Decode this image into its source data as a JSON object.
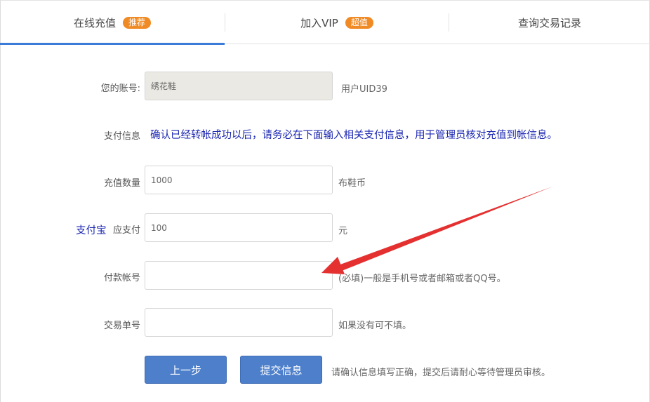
{
  "tabs": [
    {
      "label": "在线充值",
      "badge": "推荐",
      "active": true
    },
    {
      "label": "加入VIP",
      "badge": "超值",
      "active": false
    },
    {
      "label": "查询交易记录",
      "badge": "",
      "active": false
    }
  ],
  "form": {
    "account": {
      "label": "您的账号:",
      "value": "绣花鞋",
      "suffix": "用户UID39"
    },
    "payinfo": {
      "label": "支付信息",
      "notice": "确认已经转帐成功以后，请务必在下面输入相关支付信息，用于管理员核对充值到帐信息。"
    },
    "amount": {
      "label": "充值数量",
      "value": "1000",
      "unit": "布鞋币"
    },
    "pay": {
      "method": "支付宝",
      "label": "应支付",
      "value": "100",
      "unit": "元"
    },
    "payer_account": {
      "label": "付款帐号",
      "value": "",
      "hint": "(必填)一般是手机号或者邮箱或者QQ号。"
    },
    "trade_no": {
      "label": "交易单号",
      "value": "",
      "hint": "如果没有可不填。"
    }
  },
  "buttons": {
    "prev": "上一步",
    "submit": "提交信息"
  },
  "footnote": "请确认信息填写正确，提交后请耐心等待管理员审核。",
  "colors": {
    "accent": "#3d7bd9",
    "badge": "#f08a24",
    "button": "#4d7fcb",
    "notice": "#1a25b0",
    "arrow": "#e53030"
  }
}
